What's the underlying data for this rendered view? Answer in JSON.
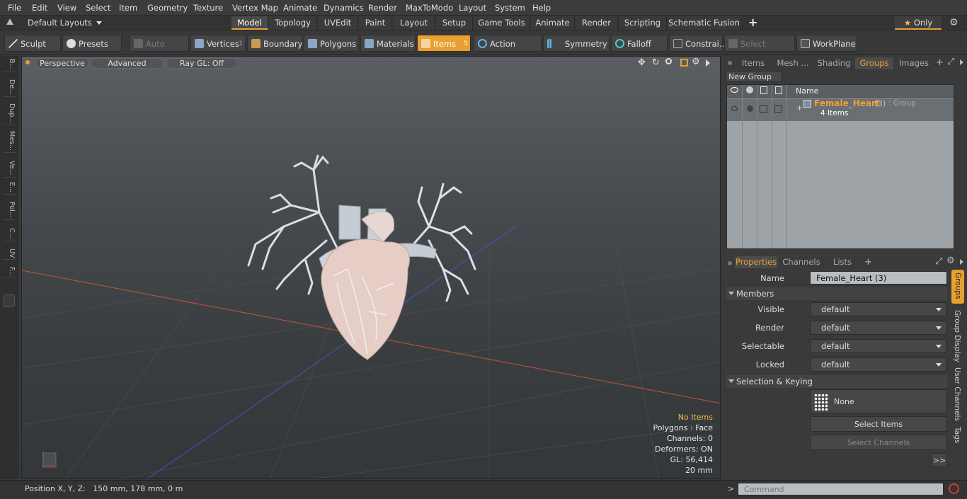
{
  "menu": [
    "File",
    "Edit",
    "View",
    "Select",
    "Item",
    "Geometry",
    "Texture",
    "Vertex Map",
    "Animate",
    "Dynamics",
    "Render",
    "MaxToModo",
    "Layout",
    "System",
    "Help"
  ],
  "layouts_label": "Default Layouts",
  "mode_tabs": [
    "Model",
    "Topology",
    "UVEdit",
    "Paint",
    "Layout",
    "Setup",
    "Game Tools",
    "Animate",
    "Render",
    "Scripting",
    "Schematic Fusion"
  ],
  "active_mode_tab": "Model",
  "only_label": "Only",
  "toolbar": {
    "sculpt": "Sculpt",
    "presets": "Presets",
    "auto_select": "Auto Select",
    "vertices": "Vertices",
    "vertices_count": "1",
    "boundary": "Boundary",
    "polygons": "Polygons",
    "materials": "Materials",
    "items": "Items",
    "items_count": "5",
    "action_center": "Action Center",
    "symmetry": "Symmetry",
    "falloff": "Falloff",
    "constraints": "Constrai...",
    "select_through": "Select Through",
    "workplane": "WorkPlane"
  },
  "left_strip": [
    "B...",
    "De...",
    "Dup...",
    "Mes...",
    "Ve...",
    "E...",
    "Pol...",
    "C...",
    "UV",
    "F..."
  ],
  "viewport": {
    "perspective": "Perspective",
    "advanced": "Advanced",
    "raygl": "Ray GL: Off",
    "stats": {
      "no_items": "No Items",
      "polygons": "Polygons : Face",
      "channels": "Channels: 0",
      "deformers": "Deformers: ON",
      "gl": "GL: 56,414",
      "scale": "20 mm"
    }
  },
  "right_tabs": [
    "Items",
    "Mesh ...",
    "Shading",
    "Groups",
    "Images"
  ],
  "active_right_tab": "Groups",
  "new_group": "New Group",
  "list_header_name": "Name",
  "group": {
    "name": "Female_Heart",
    "count": "(3)",
    "type": ": Group",
    "items": "4 Items"
  },
  "prop_tabs": [
    "Properties",
    "Channels",
    "Lists"
  ],
  "active_prop_tab": "Properties",
  "props": {
    "name_label": "Name",
    "name_value": "Female_Heart (3)",
    "members": "Members",
    "visible_label": "Visible",
    "visible_value": "default",
    "render_label": "Render",
    "render_value": "default",
    "selectable_label": "Selectable",
    "selectable_value": "default",
    "locked_label": "Locked",
    "locked_value": "default",
    "sel_keying": "Selection & Keying",
    "none": "None",
    "select_items": "Select Items",
    "select_channels": "Select Channels",
    "more": ">>"
  },
  "side_tabs": [
    "Groups",
    "Group Display",
    "User Channels",
    "Tags"
  ],
  "status": {
    "position": "Position X, Y, Z:   150 mm, 178 mm, 0 m",
    "command_placeholder": "Command"
  },
  "colors": {
    "accent": "#e8a030",
    "heart_tissue": "#e6cdc6",
    "vessels": "#c8d0d8"
  }
}
